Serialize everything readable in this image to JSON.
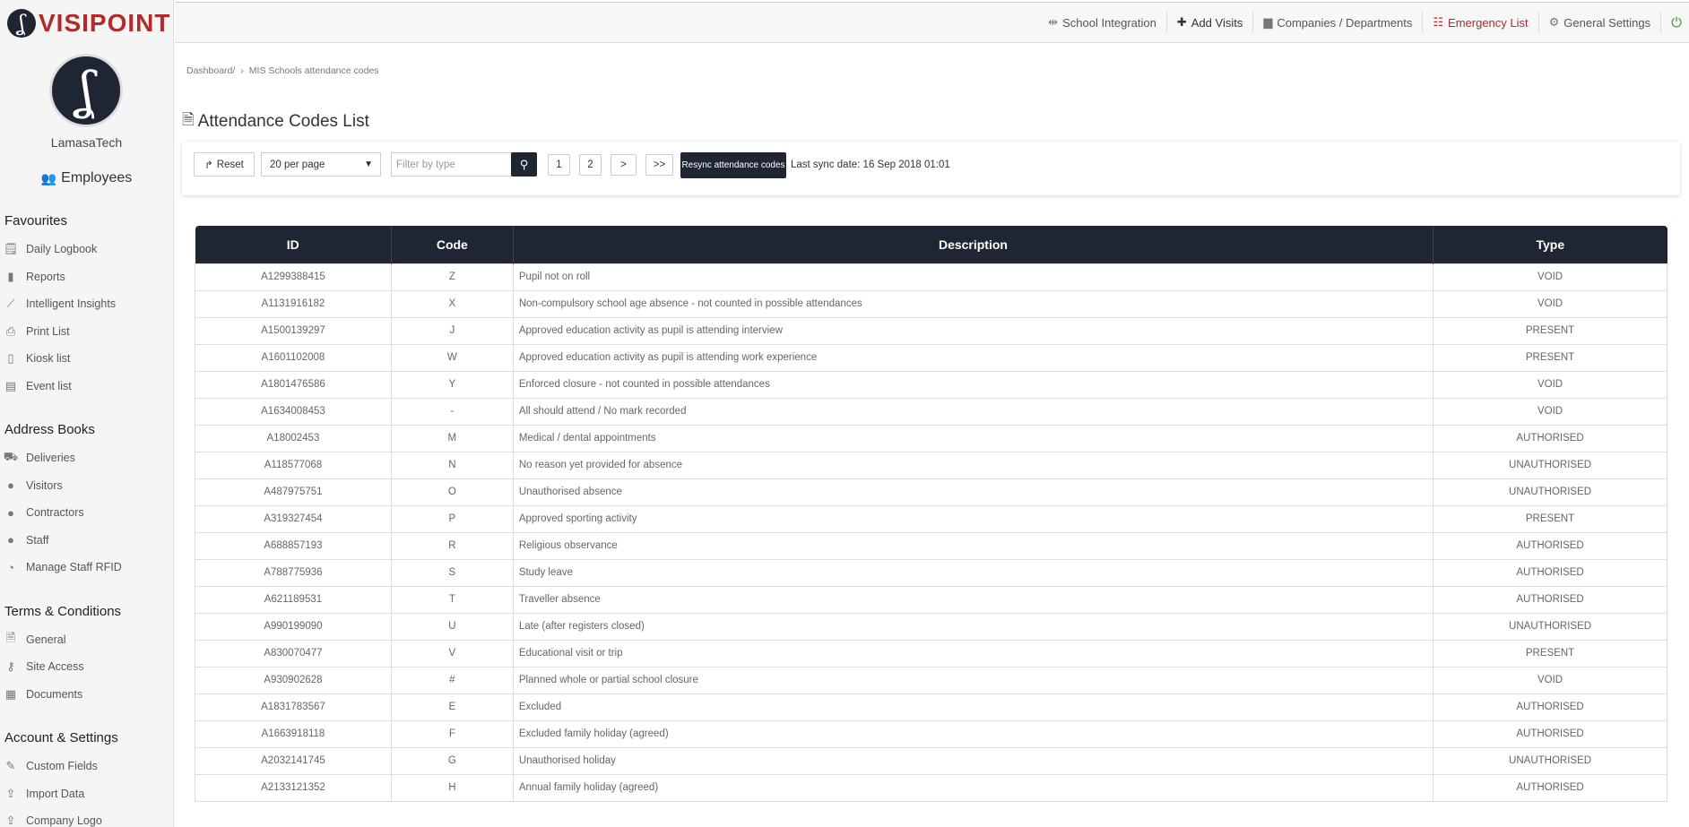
{
  "brand": {
    "logo_text": "VISIPOINT"
  },
  "user": {
    "name": "LamasaTech"
  },
  "sidebar": {
    "employees_label": "Employees",
    "sections": [
      {
        "title": "Favourites",
        "items": [
          {
            "label": "Daily Logbook",
            "icon": "logbook-icon"
          },
          {
            "label": "Reports",
            "icon": "bar-chart-icon"
          },
          {
            "label": "Intelligent Insights",
            "icon": "line-chart-icon"
          },
          {
            "label": "Print List",
            "icon": "printer-icon"
          },
          {
            "label": "Kiosk list",
            "icon": "kiosk-icon"
          },
          {
            "label": "Event list",
            "icon": "event-icon"
          }
        ]
      },
      {
        "title": "Address Books",
        "items": [
          {
            "label": "Deliveries",
            "icon": "truck-icon"
          },
          {
            "label": "Visitors",
            "icon": "user-icon"
          },
          {
            "label": "Contractors",
            "icon": "user-icon"
          },
          {
            "label": "Staff",
            "icon": "user-icon"
          },
          {
            "label": "Manage Staff RFID",
            "icon": "rfid-icon"
          }
        ]
      },
      {
        "title": "Terms & Conditions",
        "items": [
          {
            "label": "General",
            "icon": "document-icon"
          },
          {
            "label": "Site Access",
            "icon": "key-icon"
          },
          {
            "label": "Documents",
            "icon": "documents-icon"
          }
        ]
      },
      {
        "title": "Account & Settings",
        "items": [
          {
            "label": "Custom Fields",
            "icon": "wrench-icon"
          },
          {
            "label": "Import Data",
            "icon": "upload-icon"
          },
          {
            "label": "Company Logo",
            "icon": "upload-icon"
          }
        ]
      }
    ]
  },
  "topbar": {
    "items": [
      {
        "label": "School Integration",
        "icon": "integration-icon"
      },
      {
        "label": "Add Visits",
        "icon": "plus-icon"
      },
      {
        "label": "Companies / Departments",
        "icon": "briefcase-icon"
      },
      {
        "label": "Emergency List",
        "icon": "list-icon"
      },
      {
        "label": "General Settings",
        "icon": "gear-icon"
      }
    ]
  },
  "breadcrumb": {
    "root": "Dashboard/",
    "current": "MIS Schools attendance codes"
  },
  "page": {
    "title": "Attendance Codes List"
  },
  "toolbar": {
    "reset_label": "Reset",
    "per_page": "20 per page",
    "filter_placeholder": "Filter by type",
    "pages": [
      "1",
      "2"
    ],
    "next_label": ">",
    "last_label": ">>",
    "resync_label": "Resync attendance codes",
    "sync_text": "Last sync date: 16 Sep 2018 01:01"
  },
  "table": {
    "headers": [
      "ID",
      "Code",
      "Description",
      "Type"
    ],
    "rows": [
      [
        "A1299388415",
        "Z",
        "Pupil not on roll",
        "VOID"
      ],
      [
        "A1131916182",
        "X",
        "Non-compulsory school age absence - not counted in possible attendances",
        "VOID"
      ],
      [
        "A1500139297",
        "J",
        "Approved education activity as pupil is attending interview",
        "PRESENT"
      ],
      [
        "A1601102008",
        "W",
        "Approved education activity as pupil is attending work experience",
        "PRESENT"
      ],
      [
        "A1801476586",
        "Y",
        "Enforced closure - not counted in possible attendances",
        "VOID"
      ],
      [
        "A1634008453",
        "-",
        "All should attend / No mark recorded",
        "VOID"
      ],
      [
        "A18002453",
        "M",
        "Medical / dental appointments",
        "AUTHORISED"
      ],
      [
        "A118577068",
        "N",
        "No reason yet provided for absence",
        "UNAUTHORISED"
      ],
      [
        "A487975751",
        "O",
        "Unauthorised absence",
        "UNAUTHORISED"
      ],
      [
        "A319327454",
        "P",
        "Approved sporting activity",
        "PRESENT"
      ],
      [
        "A688857193",
        "R",
        "Religious observance",
        "AUTHORISED"
      ],
      [
        "A788775936",
        "S",
        "Study leave",
        "AUTHORISED"
      ],
      [
        "A621189531",
        "T",
        "Traveller absence",
        "AUTHORISED"
      ],
      [
        "A990199090",
        "U",
        "Late (after registers closed)",
        "UNAUTHORISED"
      ],
      [
        "A830070477",
        "V",
        "Educational visit or trip",
        "PRESENT"
      ],
      [
        "A930902628",
        "#",
        "Planned whole or partial school closure",
        "VOID"
      ],
      [
        "A1831783567",
        "E",
        "Excluded",
        "AUTHORISED"
      ],
      [
        "A1663918118",
        "F",
        "Excluded family holiday (agreed)",
        "AUTHORISED"
      ],
      [
        "A2032141745",
        "G",
        "Unauthorised holiday",
        "UNAUTHORISED"
      ],
      [
        "A2133121352",
        "H",
        "Annual family holiday (agreed)",
        "AUTHORISED"
      ]
    ]
  }
}
